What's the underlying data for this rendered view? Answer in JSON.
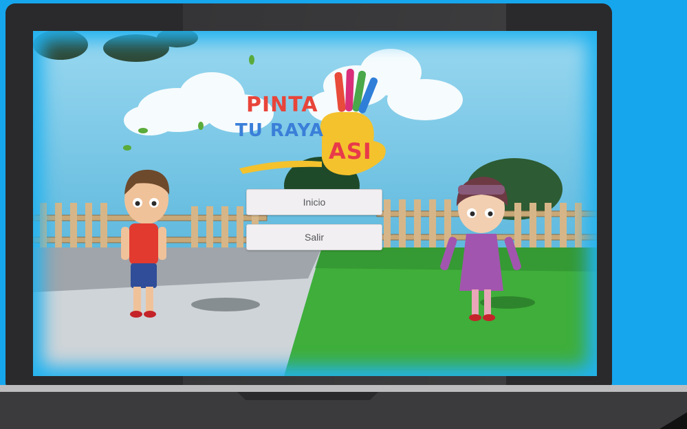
{
  "game": {
    "logo": {
      "line1": "PINTA",
      "line2": "TU RAYA",
      "hand_text": "ASI"
    },
    "menu": {
      "start_label": "Inicio",
      "exit_label": "Salir"
    }
  },
  "colors": {
    "background": "#16a6ee",
    "laptop_frame": "#2a2a2c",
    "sky": "#6fc9ea",
    "grass": "#3fae3a",
    "button_face": "#f1eff1",
    "button_text": "#55555a"
  }
}
